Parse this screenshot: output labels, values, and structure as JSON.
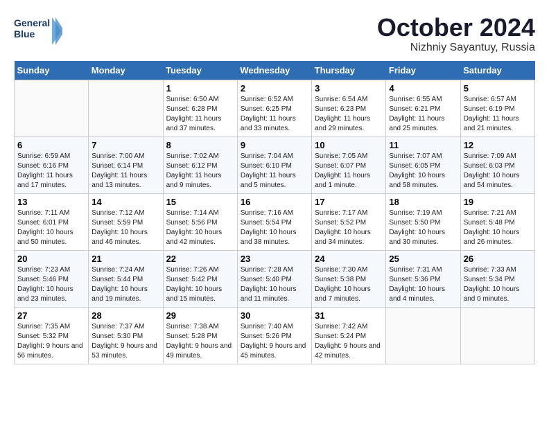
{
  "logo": {
    "line1": "General",
    "line2": "Blue"
  },
  "title": "October 2024",
  "subtitle": "Nizhniy Sayantuy, Russia",
  "days_of_week": [
    "Sunday",
    "Monday",
    "Tuesday",
    "Wednesday",
    "Thursday",
    "Friday",
    "Saturday"
  ],
  "weeks": [
    [
      {
        "day": "",
        "content": ""
      },
      {
        "day": "",
        "content": ""
      },
      {
        "day": "1",
        "content": "Sunrise: 6:50 AM\nSunset: 6:28 PM\nDaylight: 11 hours and 37 minutes."
      },
      {
        "day": "2",
        "content": "Sunrise: 6:52 AM\nSunset: 6:25 PM\nDaylight: 11 hours and 33 minutes."
      },
      {
        "day": "3",
        "content": "Sunrise: 6:54 AM\nSunset: 6:23 PM\nDaylight: 11 hours and 29 minutes."
      },
      {
        "day": "4",
        "content": "Sunrise: 6:55 AM\nSunset: 6:21 PM\nDaylight: 11 hours and 25 minutes."
      },
      {
        "day": "5",
        "content": "Sunrise: 6:57 AM\nSunset: 6:19 PM\nDaylight: 11 hours and 21 minutes."
      }
    ],
    [
      {
        "day": "6",
        "content": "Sunrise: 6:59 AM\nSunset: 6:16 PM\nDaylight: 11 hours and 17 minutes."
      },
      {
        "day": "7",
        "content": "Sunrise: 7:00 AM\nSunset: 6:14 PM\nDaylight: 11 hours and 13 minutes."
      },
      {
        "day": "8",
        "content": "Sunrise: 7:02 AM\nSunset: 6:12 PM\nDaylight: 11 hours and 9 minutes."
      },
      {
        "day": "9",
        "content": "Sunrise: 7:04 AM\nSunset: 6:10 PM\nDaylight: 11 hours and 5 minutes."
      },
      {
        "day": "10",
        "content": "Sunrise: 7:05 AM\nSunset: 6:07 PM\nDaylight: 11 hours and 1 minute."
      },
      {
        "day": "11",
        "content": "Sunrise: 7:07 AM\nSunset: 6:05 PM\nDaylight: 10 hours and 58 minutes."
      },
      {
        "day": "12",
        "content": "Sunrise: 7:09 AM\nSunset: 6:03 PM\nDaylight: 10 hours and 54 minutes."
      }
    ],
    [
      {
        "day": "13",
        "content": "Sunrise: 7:11 AM\nSunset: 6:01 PM\nDaylight: 10 hours and 50 minutes."
      },
      {
        "day": "14",
        "content": "Sunrise: 7:12 AM\nSunset: 5:59 PM\nDaylight: 10 hours and 46 minutes."
      },
      {
        "day": "15",
        "content": "Sunrise: 7:14 AM\nSunset: 5:56 PM\nDaylight: 10 hours and 42 minutes."
      },
      {
        "day": "16",
        "content": "Sunrise: 7:16 AM\nSunset: 5:54 PM\nDaylight: 10 hours and 38 minutes."
      },
      {
        "day": "17",
        "content": "Sunrise: 7:17 AM\nSunset: 5:52 PM\nDaylight: 10 hours and 34 minutes."
      },
      {
        "day": "18",
        "content": "Sunrise: 7:19 AM\nSunset: 5:50 PM\nDaylight: 10 hours and 30 minutes."
      },
      {
        "day": "19",
        "content": "Sunrise: 7:21 AM\nSunset: 5:48 PM\nDaylight: 10 hours and 26 minutes."
      }
    ],
    [
      {
        "day": "20",
        "content": "Sunrise: 7:23 AM\nSunset: 5:46 PM\nDaylight: 10 hours and 23 minutes."
      },
      {
        "day": "21",
        "content": "Sunrise: 7:24 AM\nSunset: 5:44 PM\nDaylight: 10 hours and 19 minutes."
      },
      {
        "day": "22",
        "content": "Sunrise: 7:26 AM\nSunset: 5:42 PM\nDaylight: 10 hours and 15 minutes."
      },
      {
        "day": "23",
        "content": "Sunrise: 7:28 AM\nSunset: 5:40 PM\nDaylight: 10 hours and 11 minutes."
      },
      {
        "day": "24",
        "content": "Sunrise: 7:30 AM\nSunset: 5:38 PM\nDaylight: 10 hours and 7 minutes."
      },
      {
        "day": "25",
        "content": "Sunrise: 7:31 AM\nSunset: 5:36 PM\nDaylight: 10 hours and 4 minutes."
      },
      {
        "day": "26",
        "content": "Sunrise: 7:33 AM\nSunset: 5:34 PM\nDaylight: 10 hours and 0 minutes."
      }
    ],
    [
      {
        "day": "27",
        "content": "Sunrise: 7:35 AM\nSunset: 5:32 PM\nDaylight: 9 hours and 56 minutes."
      },
      {
        "day": "28",
        "content": "Sunrise: 7:37 AM\nSunset: 5:30 PM\nDaylight: 9 hours and 53 minutes."
      },
      {
        "day": "29",
        "content": "Sunrise: 7:38 AM\nSunset: 5:28 PM\nDaylight: 9 hours and 49 minutes."
      },
      {
        "day": "30",
        "content": "Sunrise: 7:40 AM\nSunset: 5:26 PM\nDaylight: 9 hours and 45 minutes."
      },
      {
        "day": "31",
        "content": "Sunrise: 7:42 AM\nSunset: 5:24 PM\nDaylight: 9 hours and 42 minutes."
      },
      {
        "day": "",
        "content": ""
      },
      {
        "day": "",
        "content": ""
      }
    ]
  ]
}
